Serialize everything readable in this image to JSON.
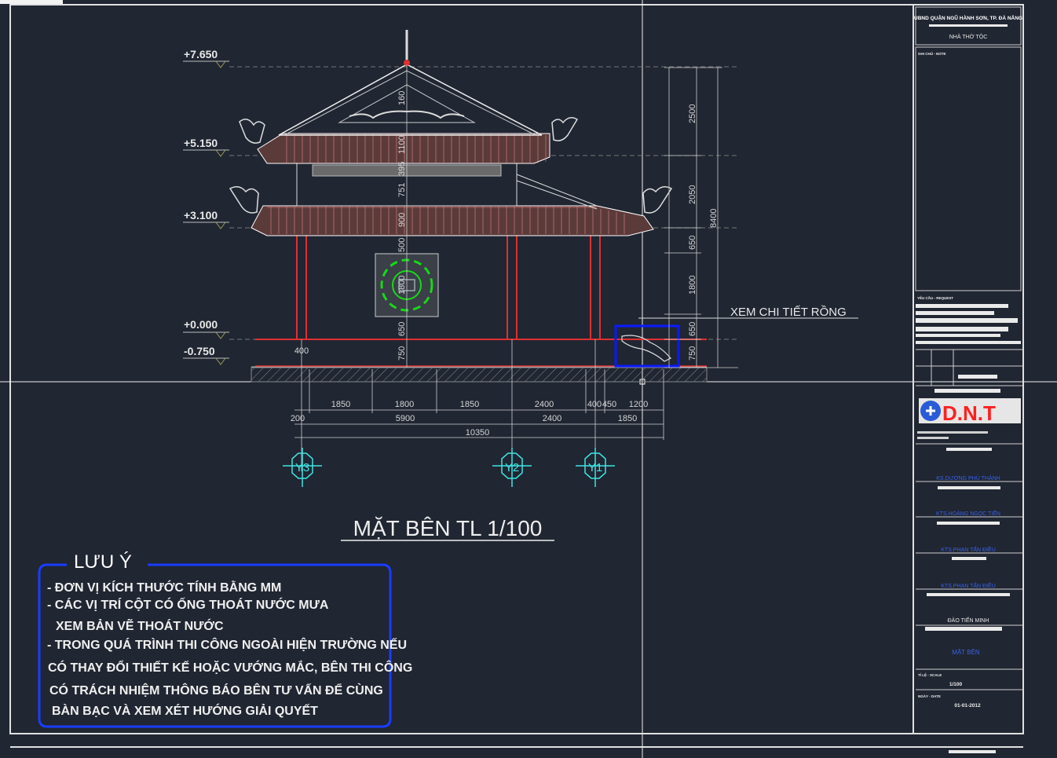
{
  "levels": [
    "+7.650",
    "+5.150",
    "+3.100",
    "+0.000",
    "-0.750"
  ],
  "vertical_dims": {
    "center": [
      "160",
      "1100",
      "395",
      "751",
      "900",
      "500",
      "1800",
      "650",
      "750"
    ],
    "right": [
      "2500",
      "2050",
      "650",
      "1800",
      "650",
      "750"
    ],
    "overall": "8400"
  },
  "horizontal_dims": {
    "row1": [
      "1850",
      "1800",
      "1850",
      "2400",
      "400",
      "450",
      "1200"
    ],
    "row2": [
      "200",
      "5900",
      "2400",
      "1850"
    ],
    "total": "10350",
    "col_left": "400"
  },
  "axes": [
    "Y3",
    "Y2",
    "Y1"
  ],
  "callout": "XEM CHI TIẾT RỒNG",
  "drawing_title": "MẶT BÊN TL 1/100",
  "note": {
    "heading": "LƯU Ý",
    "lines": [
      "- ĐƠN VỊ KÍCH THƯỚC TÍNH BẰNG MM",
      "- CÁC VỊ TRÍ CỘT CÓ ỐNG THOÁT NƯỚC MƯA",
      "XEM BẢN VẼ THOÁT NƯỚC",
      "- TRONG QUÁ TRÌNH THI CÔNG NGOÀI HIỆN TRƯỜNG NẾU",
      "CÓ THAY ĐỔI THIẾT KẾ HOẶC VƯỚNG MẮC, BÊN THI CÔNG",
      "CÓ TRÁCH NHIỆM THÔNG BÁO BÊN TƯ VẤN ĐỂ CÙNG",
      "BÀN BẠC VÀ XEM XÉT HƯỚNG GIẢI QUYẾT"
    ]
  },
  "title_block": {
    "owner": "UBND QUẬN NGŨ HÀNH SƠN, TP. ĐÀ NẴNG",
    "project": "NHÀ THỜ TỘC",
    "ghi_chu": "GHI CHÚ - NOTE",
    "yeu_cau": "YÊU CẦU - REQUEST",
    "company_logo": "D.N.T",
    "people": [
      "KS.DƯƠNG PHÚ THÀNH",
      "KTS.HOÀNG NGỌC TIẾN",
      "KTS.PHAN TẤN ĐIỀU",
      "KTS.PHAN TẤN ĐIỀU",
      "ĐÀO TIẾN MINH"
    ],
    "sheet_name": "MẶT BÊN",
    "scale_label": "TỈ LỆ - SCALE",
    "scale": "1/100",
    "date_label": "NGÀY - DATE",
    "date": "01-01-2012"
  },
  "colors": {
    "background": "#202632",
    "frame": "#ffffff",
    "column_red": "#e03030",
    "dimension": "#cfcfcf",
    "note_border": "#1a3cff",
    "detail_box": "#0a1aff",
    "ornament_green": "#19d719",
    "logo_red": "#ff2020",
    "logo_blue": "#2a5bd7"
  }
}
